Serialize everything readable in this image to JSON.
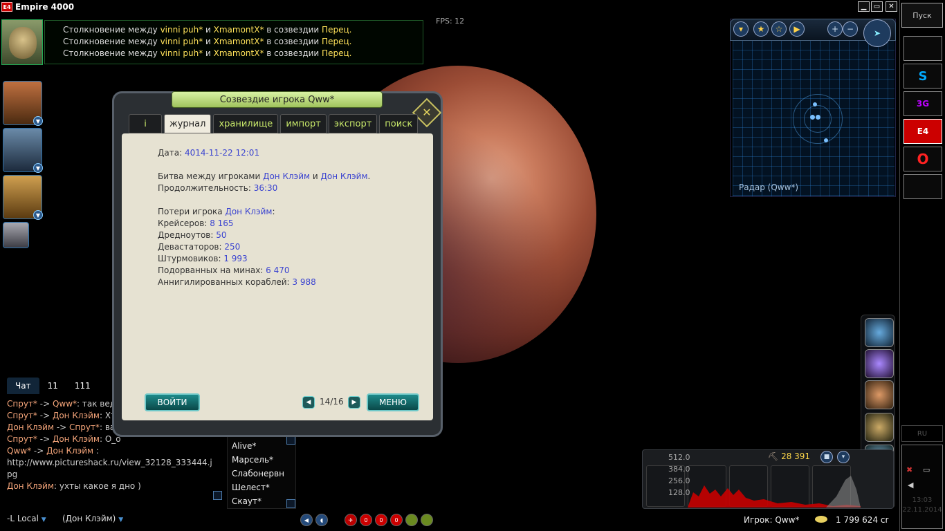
{
  "window": {
    "logo": "E4",
    "title": "Empire 4000",
    "buttons": [
      "▁",
      "▭",
      "✕"
    ]
  },
  "fps": "FPS: 12",
  "news": [
    {
      "prefix": "Столкновение между ",
      "p1": "vinni puh*",
      "mid": " и ",
      "p2": "XmamontX*",
      "mid2": " в созвездии ",
      "place": "Перец."
    },
    {
      "prefix": "Столкновение между ",
      "p1": "vinni puh*",
      "mid": " и ",
      "p2": "XmamontX*",
      "mid2": " в созвездии ",
      "place": "Перец."
    },
    {
      "prefix": "Столкновение между ",
      "p1": "vinni puh*",
      "mid": " и ",
      "p2": "XmamontX*",
      "mid2": " в созвездии ",
      "place": "Перец."
    }
  ],
  "dialog": {
    "title": "Созвездие игрока Qww*",
    "close_glyph": "✕",
    "tabs": [
      "i",
      "журнал",
      "хранилище",
      "импорт",
      "экспорт",
      "поиск"
    ],
    "active_tab": "журнал",
    "journal": {
      "date_label": "Дата: ",
      "date_value": "4014-11-22 12:01",
      "battle_prefix": "Битва между игроками ",
      "battle_p1": "Дон Клэйм",
      "battle_and": " и ",
      "battle_p2": "Дон Клэйм",
      "battle_end": ".",
      "duration_label": "Продолжительность: ",
      "duration_value": "36:30",
      "losses_label": "Потери игрока ",
      "losses_player": "Дон Клэйм",
      "losses_end": ":",
      "rows": [
        {
          "label": "Крейсеров: ",
          "value": "8 165"
        },
        {
          "label": "Дредноутов: ",
          "value": "50"
        },
        {
          "label": "Девастаторов: ",
          "value": "250"
        },
        {
          "label": "Штурмовиков: ",
          "value": "1 993"
        },
        {
          "label": "Подорванных на минах: ",
          "value": "6 470"
        },
        {
          "label": "Аннигилированных кораблей: ",
          "value": "3 988"
        }
      ]
    },
    "enter_button": "ВОЙТИ",
    "menu_button": "МЕНЮ",
    "pager": "14/16"
  },
  "chat": {
    "tabs": [
      "Чат",
      "11",
      "111"
    ],
    "lines": [
      {
        "from": "Спрут*",
        "arrow": " -> ",
        "to": "Qww*",
        "text": ": так ведь"
      },
      {
        "from": "Спрут*",
        "arrow": " -> ",
        "to": "Дон Клэйм",
        "text": ": Хто"
      },
      {
        "from": "Дон Клэйм",
        "arrow": " -> ",
        "to": "Спрут*",
        "text": ": вап"
      },
      {
        "from": "Спрут*",
        "arrow": " -> ",
        "to": "Дон Клэйм",
        "text": ": О_о"
      },
      {
        "from": "Qww*",
        "arrow": " -> ",
        "to": "Дон Клэйм",
        "text": " :"
      }
    ],
    "url_line1": "http://www.pictureshack.ru/view_32128_333444.j",
    "url_line2": "pg",
    "last_from": "Дон Клэйм",
    "last_text": ": ухты какое я дно )",
    "channel": "-L Local",
    "who": "(Дон Клэйм)"
  },
  "players": [
    "Alive*",
    "Марсель*",
    "Слабонервн",
    "Шелест*",
    "Скаут*"
  ],
  "radar": {
    "label": "Радар (Qww*)"
  },
  "economy": {
    "resource": "28 391",
    "graph_labels": [
      "512.0",
      "384.0",
      "256.0",
      "128.0"
    ]
  },
  "status": {
    "player": "Игрок: Qww*",
    "money": "1 799 624 cr"
  },
  "taskbar": {
    "start": "Пуск",
    "apps": [
      "",
      "S",
      "3G",
      "E4",
      "O",
      ""
    ],
    "lang": "RU",
    "time": "13:03",
    "date": "22.11.2014"
  },
  "colors": {
    "accent_green": "#9fc25c",
    "link_blue": "#3a43d0",
    "player_yellow": "#ffe25a",
    "chat_orange": "#f5a57a"
  }
}
